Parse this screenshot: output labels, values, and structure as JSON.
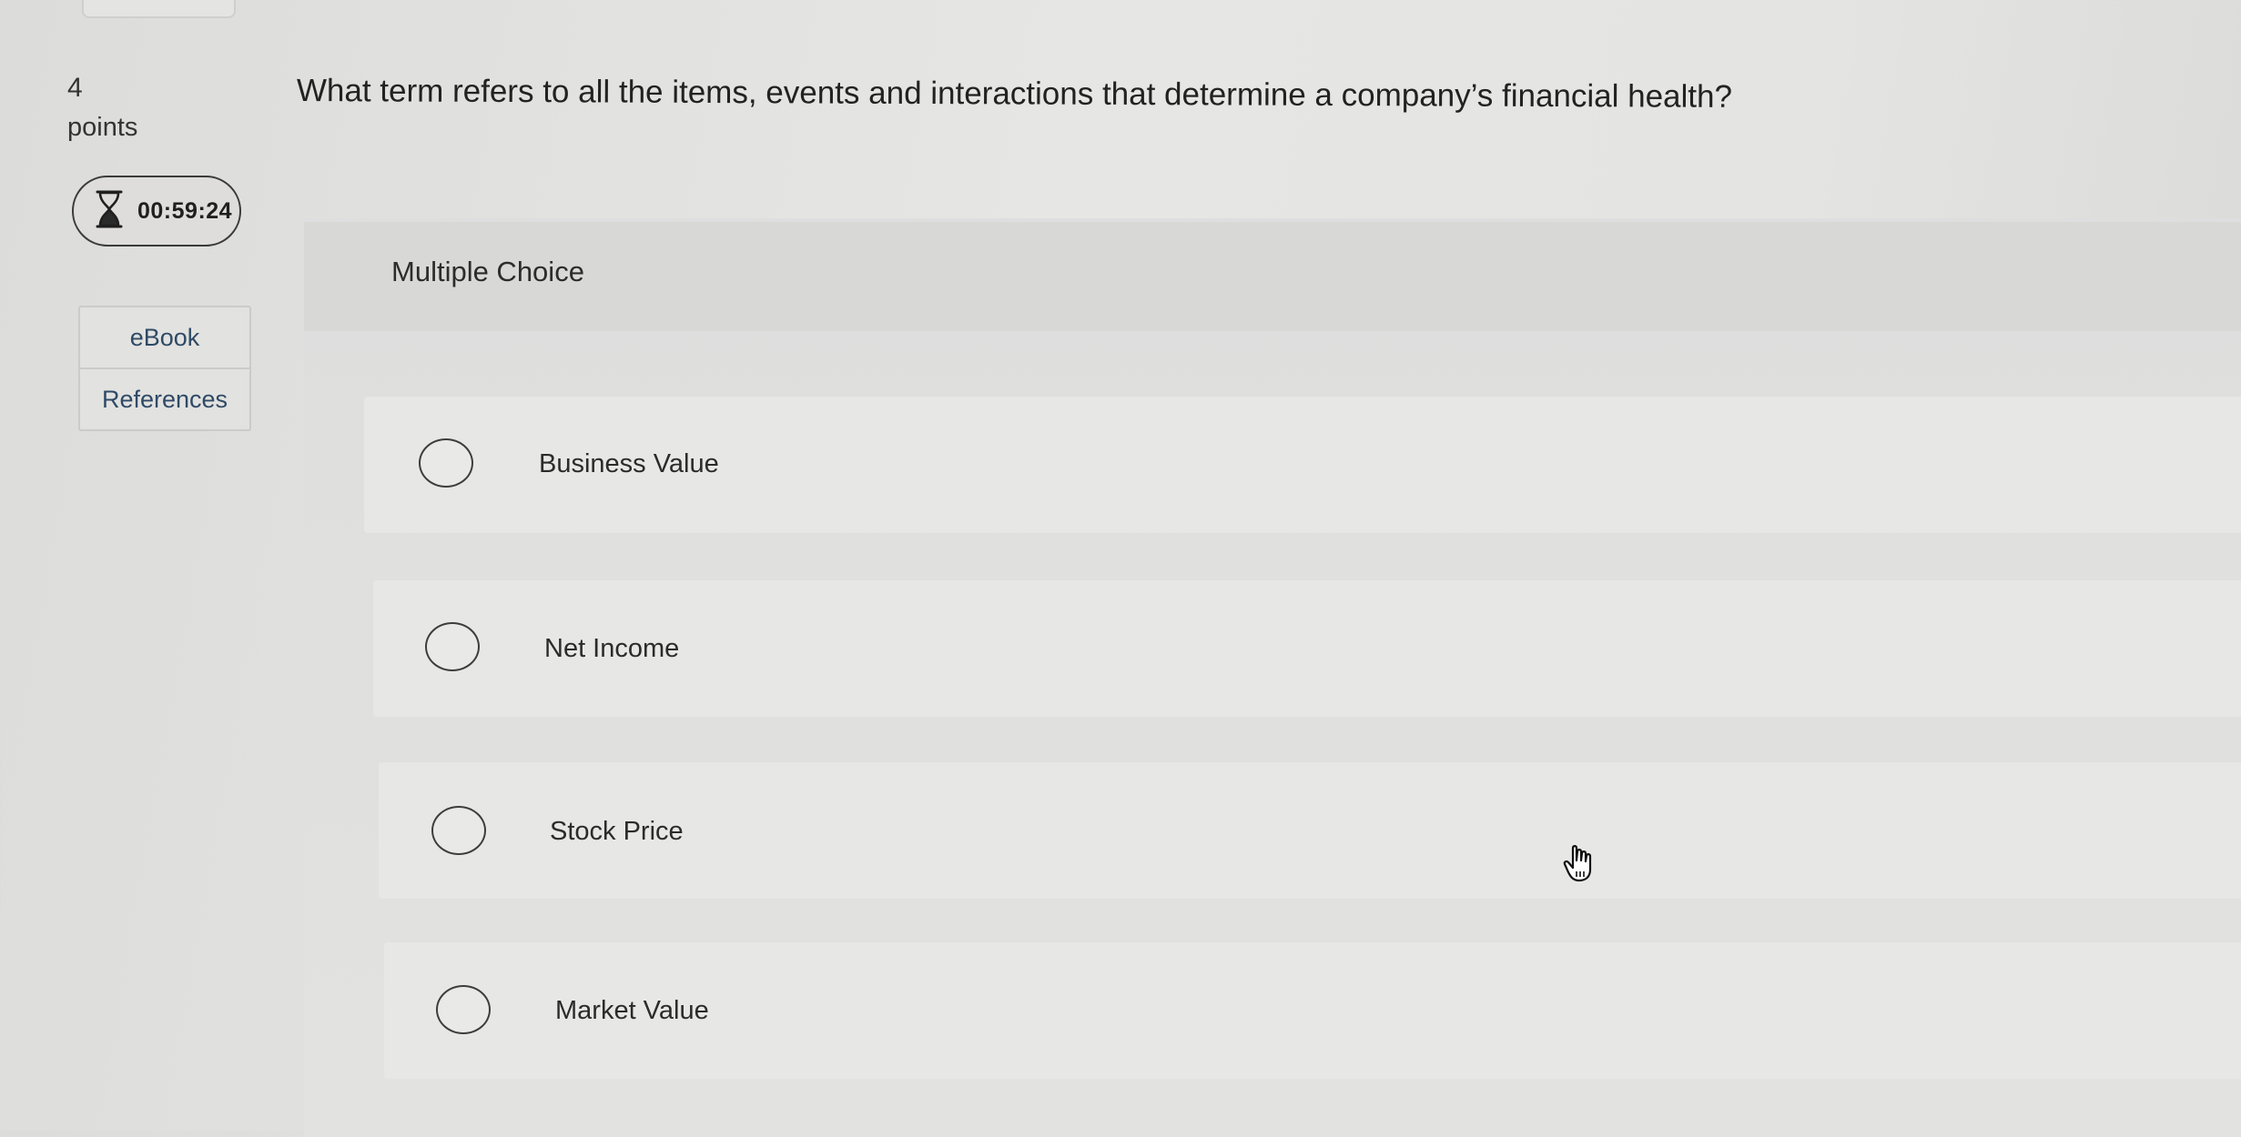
{
  "question": {
    "number": "4",
    "points_label": "points",
    "text": "What term refers to all the items, events and interactions that determine a company’s financial health?",
    "type_label": "Multiple Choice"
  },
  "timer": {
    "icon": "hourglass-icon",
    "value": "00:59:24"
  },
  "side_links": [
    {
      "label": "eBook"
    },
    {
      "label": "References"
    }
  ],
  "choices": [
    {
      "label": "Business Value",
      "selected": false
    },
    {
      "label": "Net Income",
      "selected": false
    },
    {
      "label": "Stock Price",
      "selected": false
    },
    {
      "label": "Market Value",
      "selected": false
    }
  ]
}
